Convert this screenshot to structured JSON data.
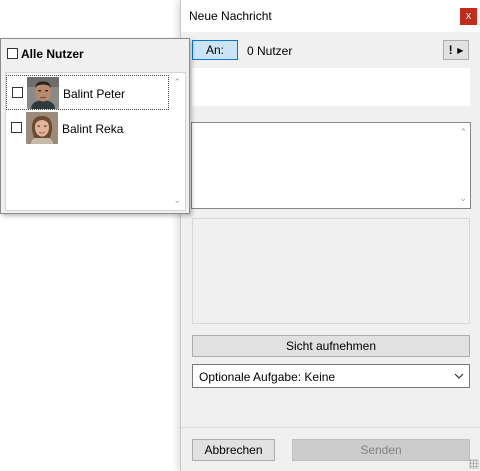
{
  "dialog": {
    "title": "Neue Nachricht",
    "close_icon": "close-icon",
    "to_button_label": "An:",
    "recipient_count": "0 Nutzer",
    "menu_button": {
      "icon_1": "exclamation-icon",
      "icon_2": "triangle-right-icon"
    },
    "recipients_value": "",
    "message_value": "",
    "capture_view_label": "Sicht aufnehmen",
    "task_select": {
      "selected": "Optionale Aufgabe: Keine"
    },
    "cancel_label": "Abbrechen",
    "send_label": "Senden"
  },
  "user_picker": {
    "all_users_label": "Alle Nutzer",
    "all_users_checked": false,
    "users": [
      {
        "name": "Balint Peter",
        "checked": false,
        "focused": true
      },
      {
        "name": "Balint Reka",
        "checked": false,
        "focused": false
      }
    ]
  },
  "colors": {
    "accent_button_bg": "#cce4f7",
    "accent_border": "#0078d7",
    "close_red": "#c42b1c",
    "window_bg": "#f0f0f0"
  }
}
